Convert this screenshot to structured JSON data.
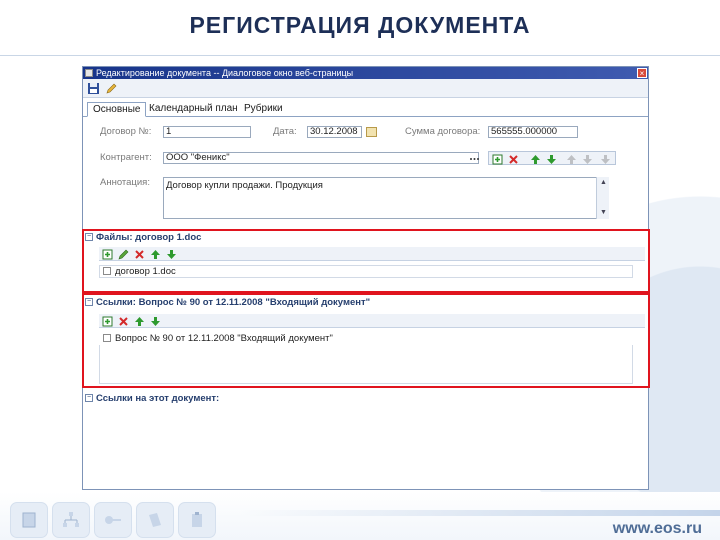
{
  "slide": {
    "title": "РЕГИСТРАЦИЯ ДОКУМЕНТА",
    "website": "www.eos.ru"
  },
  "window": {
    "title": "Редактирование документа -- Диалоговое окно веб-страницы",
    "close_glyph": "×"
  },
  "tabs": [
    {
      "label": "Основные",
      "active": true
    },
    {
      "label": "Календарный план",
      "active": false
    },
    {
      "label": "Рубрики",
      "active": false
    }
  ],
  "form": {
    "contract_number_label": "Договор №:",
    "contract_number_value": "1",
    "date_label": "Дата:",
    "date_value": "30.12.2008",
    "amount_label": "Сумма договора:",
    "amount_value": "565555.000000",
    "counterparty_label": "Контрагент:",
    "counterparty_value": "ООО \"Феникс\"",
    "annotation_label": "Аннотация:",
    "annotation_value": "Договор купли продажи. Продукция"
  },
  "files_section": {
    "header": "Файлы: договор 1.doc",
    "toggle": "−",
    "items": [
      {
        "name": "договор 1.doc"
      }
    ]
  },
  "links_section": {
    "header": "Ссылки: Вопрос № 90 от 12.11.2008 \"Входящий документ\"",
    "toggle": "−",
    "items": [
      {
        "name": "Вопрос № 90 от 12.11.2008 \"Входящий документ\""
      }
    ]
  },
  "backlinks_section": {
    "header": "Ссылки на этот документ:",
    "toggle": "−"
  },
  "icons": {
    "save": "save-icon",
    "edit": "edit-icon",
    "add": "add-icon",
    "delete": "delete-icon",
    "up": "arrow-up-icon",
    "down": "arrow-down-icon",
    "calendar": "calendar-icon",
    "dropdown": "dropdown-icon"
  },
  "colors": {
    "accent": "#1d2f57",
    "highlight": "#e0141e",
    "titlebar": "#17348a",
    "delete": "#d42a2a",
    "move": "#2e9a2e"
  }
}
